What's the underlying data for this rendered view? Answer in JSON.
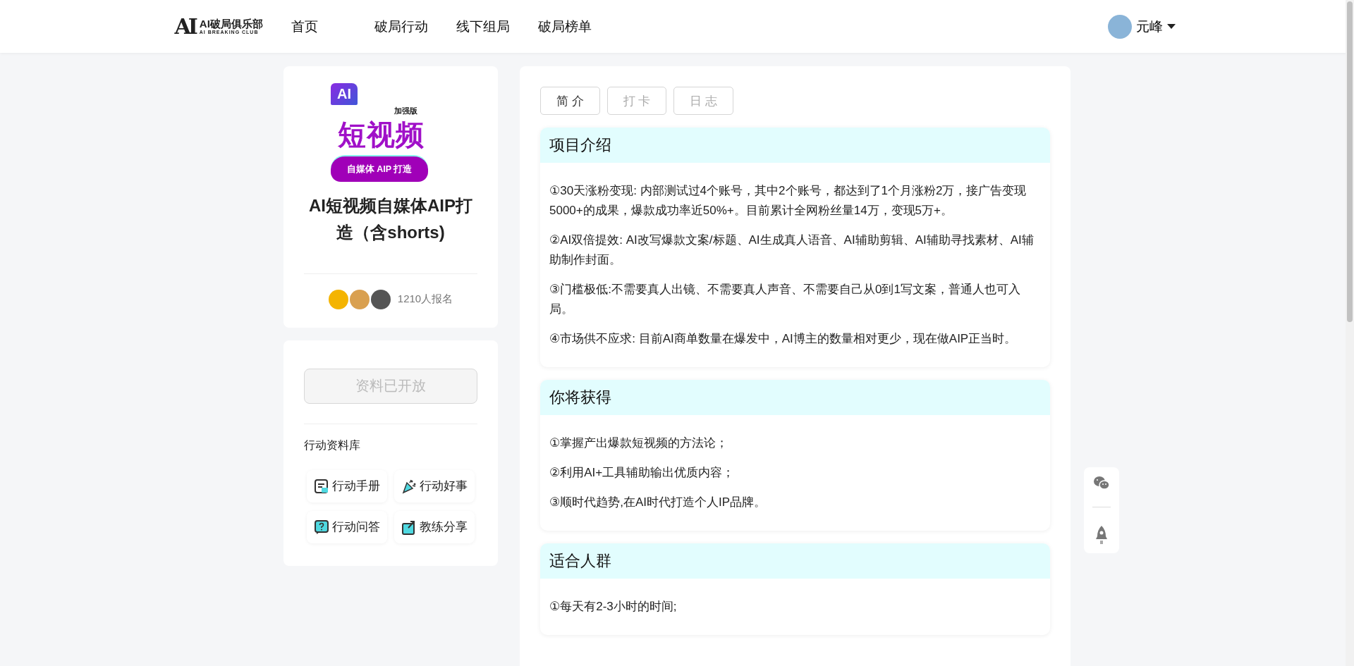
{
  "header": {
    "logo": {
      "mark": "AI",
      "title": "AI破局俱乐部",
      "subtitle": "AI BREAKING CLUB"
    },
    "nav": [
      {
        "label": "首页",
        "selected": false
      },
      {
        "label": "破局行动",
        "selected": false
      },
      {
        "label": "线下组局",
        "selected": false
      },
      {
        "label": "破局榜单",
        "selected": false
      }
    ],
    "user": {
      "name": "元峰"
    }
  },
  "project": {
    "cover": {
      "badge": "AI",
      "edition": "加强版",
      "headline": "短视频",
      "ribbon": "自媒体 AIP 打造"
    },
    "title": "AI短视频自媒体AIP打造（含shorts)",
    "signup_count": "1210人报名"
  },
  "resources": {
    "button": {
      "label": "资料已开放",
      "disabled": true
    },
    "heading": "行动资料库",
    "items": [
      {
        "label": "行动手册",
        "kind": "manual"
      },
      {
        "label": "行动好事",
        "kind": "party"
      },
      {
        "label": "行动问答",
        "kind": "qa"
      },
      {
        "label": "教练分享",
        "kind": "share"
      }
    ]
  },
  "tabs": [
    {
      "label": "简 介",
      "selected": true
    },
    {
      "label": "打 卡",
      "selected": false
    },
    {
      "label": "日 志",
      "selected": false
    }
  ],
  "sections": [
    {
      "title": "项目介绍",
      "paragraphs": [
        "①30天涨粉变现: 内部测试过4个账号，其中2个账号，都达到了1个月涨粉2万，接广告变现5000+的成果，爆款成功率近50%+。目前累计全网粉丝量14万，变现5万+。",
        "②AI双倍提效: AI改写爆款文案/标题、AI生成真人语音、AI辅助剪辑、AI辅助寻找素材、AI辅助制作封面。",
        "③门槛极低:不需要真人出镜、不需要真人声音、不需要自己从0到1写文案，普通人也可入局。",
        "④市场供不应求: 目前AI商单数量在爆发中，AI博主的数量相对更少，现在做AIP正当时。"
      ]
    },
    {
      "title": "你将获得",
      "paragraphs": [
        "①掌握产出爆款短视频的方法论；",
        "②利用AI+工具辅助输出优质内容；",
        "③顺时代趋势,在AI时代打造个人IP品牌。"
      ]
    },
    {
      "title": "适合人群",
      "paragraphs": [
        "①每天有2-3小时的时间;"
      ]
    }
  ]
}
